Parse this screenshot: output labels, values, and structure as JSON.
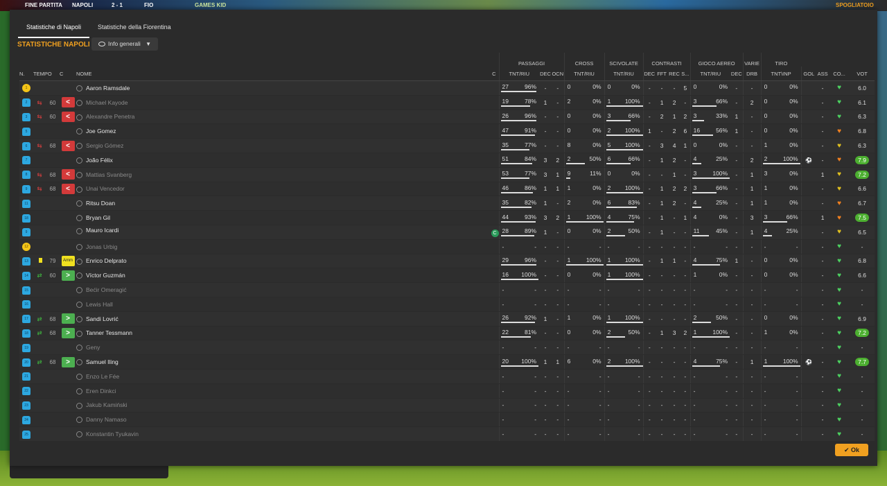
{
  "scoreboard": {
    "label": "FINE PARTITA",
    "home": "NAPOLI",
    "score": "2 - 1",
    "away": "FIO",
    "sponsor": "GAMES KID",
    "right_btn": "SPOGLIATOIO"
  },
  "tabs": [
    {
      "label": "Statistiche di Napoli",
      "active": true
    },
    {
      "label": "Statistiche della Fiorentina",
      "active": false
    }
  ],
  "section_title": "STATISTICHE NAPOLI",
  "dropdown": {
    "label": "Info generali"
  },
  "groups": {
    "passaggi": "PASSAGGI",
    "cross": "CROSS",
    "scivolate": "SCIVOLATE",
    "contrasti": "CONTRASTI",
    "gioco_aereo": "GIOCO AEREO",
    "varie": "VARIE",
    "tiro": "TIRO"
  },
  "headers": {
    "n": "N.",
    "tempo": "TEMPO",
    "c": "C",
    "nome": "NOME",
    "c2": "C",
    "pass_tnt": "TNT/RIU",
    "dec": "DEC",
    "ocn": "OCN",
    "cross_tnt": "TNT/RIU",
    "sciv_tnt": "TNT/RIU",
    "cdec": "DEC",
    "fft": "FFT",
    "rec": "REC",
    "s": "S...",
    "aer_tnt": "TNT/RIU",
    "adec": "DEC",
    "drb": "DRB",
    "tiro": "TNT\\INP",
    "gol": "GOL",
    "ass": "ASS",
    "co": "CO...",
    "vot": "VOT"
  },
  "ok_label": "Ok",
  "players": [
    {
      "n": "1",
      "gk": true,
      "tempo": "",
      "sub": "",
      "name": "Aaron Ramsdale",
      "dim": false,
      "c2": "",
      "pass": [
        "27",
        "96%"
      ],
      "dec": "-",
      "ocn": "-",
      "cross": [
        "0",
        "0%"
      ],
      "sciv": [
        "0",
        "0%"
      ],
      "cdec": "-",
      "fft": "-",
      "rec": "-",
      "s": "5",
      "aer": [
        "0",
        "0%"
      ],
      "adec": "-",
      "drb": "-",
      "tiro": [
        "0",
        "0%"
      ],
      "gol": "",
      "ass": "-",
      "heart": "g",
      "vot": "6.0",
      "good": false
    },
    {
      "n": "2",
      "gk": false,
      "tempo": "60",
      "sub": "out",
      "name": "Michael Kayode",
      "dim": true,
      "c2": "",
      "pass": [
        "19",
        "78%"
      ],
      "dec": "1",
      "ocn": "-",
      "cross": [
        "2",
        "0%"
      ],
      "sciv": [
        "1",
        "100%"
      ],
      "cdec": "-",
      "fft": "1",
      "rec": "2",
      "s": "-",
      "aer": [
        "3",
        "66%"
      ],
      "adec": "-",
      "drb": "2",
      "tiro": [
        "0",
        "0%"
      ],
      "gol": "",
      "ass": "-",
      "heart": "g",
      "vot": "6.1",
      "good": false
    },
    {
      "n": "3",
      "gk": false,
      "tempo": "60",
      "sub": "out",
      "name": "Alexandre Penetra",
      "dim": true,
      "c2": "",
      "pass": [
        "26",
        "96%"
      ],
      "dec": "-",
      "ocn": "-",
      "cross": [
        "0",
        "0%"
      ],
      "sciv": [
        "3",
        "66%"
      ],
      "cdec": "-",
      "fft": "2",
      "rec": "1",
      "s": "2",
      "aer": [
        "3",
        "33%"
      ],
      "adec": "1",
      "drb": "-",
      "tiro": [
        "0",
        "0%"
      ],
      "gol": "",
      "ass": "-",
      "heart": "g",
      "vot": "6.3",
      "good": false
    },
    {
      "n": "5",
      "gk": false,
      "tempo": "",
      "sub": "",
      "name": "Joe Gomez",
      "dim": false,
      "c2": "",
      "pass": [
        "47",
        "91%"
      ],
      "dec": "-",
      "ocn": "-",
      "cross": [
        "0",
        "0%"
      ],
      "sciv": [
        "2",
        "100%"
      ],
      "cdec": "1",
      "fft": "-",
      "rec": "2",
      "s": "6",
      "aer": [
        "16",
        "56%"
      ],
      "adec": "1",
      "drb": "-",
      "tiro": [
        "0",
        "0%"
      ],
      "gol": "",
      "ass": "-",
      "heart": "o",
      "vot": "6.8",
      "good": false
    },
    {
      "n": "6",
      "gk": false,
      "tempo": "68",
      "sub": "out",
      "name": "Sergio Gómez",
      "dim": true,
      "c2": "",
      "pass": [
        "35",
        "77%"
      ],
      "dec": "-",
      "ocn": "-",
      "cross": [
        "8",
        "0%"
      ],
      "sciv": [
        "5",
        "100%"
      ],
      "cdec": "-",
      "fft": "3",
      "rec": "4",
      "s": "1",
      "aer": [
        "0",
        "0%"
      ],
      "adec": "-",
      "drb": "-",
      "tiro": [
        "1",
        "0%"
      ],
      "gol": "",
      "ass": "-",
      "heart": "y",
      "vot": "6.3",
      "good": false
    },
    {
      "n": "7",
      "gk": false,
      "tempo": "",
      "sub": "",
      "name": "João Félix",
      "dim": false,
      "c2": "",
      "pass": [
        "51",
        "84%"
      ],
      "dec": "3",
      "ocn": "2",
      "cross": [
        "2",
        "50%"
      ],
      "sciv": [
        "6",
        "66%"
      ],
      "cdec": "-",
      "fft": "1",
      "rec": "2",
      "s": "-",
      "aer": [
        "4",
        "25%"
      ],
      "adec": "-",
      "drb": "2",
      "tiro": [
        "2",
        "100%"
      ],
      "gol": "ball",
      "ass": "-",
      "heart": "o",
      "vot": "7.9",
      "good": true
    },
    {
      "n": "8",
      "gk": false,
      "tempo": "68",
      "sub": "out",
      "name": "Mattias Svanberg",
      "dim": true,
      "c2": "",
      "pass": [
        "53",
        "77%"
      ],
      "dec": "3",
      "ocn": "1",
      "cross": [
        "9",
        "11%"
      ],
      "sciv": [
        "0",
        "0%"
      ],
      "cdec": "-",
      "fft": "-",
      "rec": "1",
      "s": "-",
      "aer": [
        "3",
        "100%"
      ],
      "adec": "-",
      "drb": "1",
      "tiro": [
        "3",
        "0%"
      ],
      "gol": "",
      "ass": "1",
      "heart": "y",
      "vot": "7.2",
      "good": true
    },
    {
      "n": "9",
      "gk": false,
      "tempo": "68",
      "sub": "out",
      "name": "Unai Vencedor",
      "dim": true,
      "c2": "",
      "pass": [
        "46",
        "86%"
      ],
      "dec": "1",
      "ocn": "1",
      "cross": [
        "1",
        "0%"
      ],
      "sciv": [
        "2",
        "100%"
      ],
      "cdec": "-",
      "fft": "1",
      "rec": "2",
      "s": "2",
      "aer": [
        "3",
        "66%"
      ],
      "adec": "-",
      "drb": "1",
      "tiro": [
        "1",
        "0%"
      ],
      "gol": "",
      "ass": "-",
      "heart": "y",
      "vot": "6.6",
      "good": false
    },
    {
      "n": "11",
      "gk": false,
      "tempo": "",
      "sub": "",
      "name": "Ritsu Doan",
      "dim": false,
      "c2": "",
      "pass": [
        "35",
        "82%"
      ],
      "dec": "1",
      "ocn": "-",
      "cross": [
        "2",
        "0%"
      ],
      "sciv": [
        "6",
        "83%"
      ],
      "cdec": "-",
      "fft": "1",
      "rec": "2",
      "s": "-",
      "aer": [
        "4",
        "25%"
      ],
      "adec": "-",
      "drb": "1",
      "tiro": [
        "1",
        "0%"
      ],
      "gol": "",
      "ass": "-",
      "heart": "o",
      "vot": "6.7",
      "good": false
    },
    {
      "n": "18",
      "gk": false,
      "tempo": "",
      "sub": "",
      "name": "Bryan Gil",
      "dim": false,
      "c2": "",
      "pass": [
        "44",
        "93%"
      ],
      "dec": "3",
      "ocn": "2",
      "cross": [
        "1",
        "100%"
      ],
      "sciv": [
        "4",
        "75%"
      ],
      "cdec": "-",
      "fft": "1",
      "rec": "-",
      "s": "1",
      "aer": [
        "4",
        "0%"
      ],
      "adec": "-",
      "drb": "3",
      "tiro": [
        "3",
        "66%"
      ],
      "gol": "",
      "ass": "1",
      "heart": "o",
      "vot": "7.5",
      "good": true
    },
    {
      "n": "9",
      "gk": false,
      "tempo": "",
      "sub": "",
      "name": "Mauro Icardi",
      "dim": false,
      "c2": "C",
      "pass": [
        "28",
        "89%"
      ],
      "dec": "1",
      "ocn": "-",
      "cross": [
        "0",
        "0%"
      ],
      "sciv": [
        "2",
        "50%"
      ],
      "cdec": "-",
      "fft": "1",
      "rec": "-",
      "s": "-",
      "aer": [
        "11",
        "45%"
      ],
      "adec": "-",
      "drb": "1",
      "tiro": [
        "4",
        "25%"
      ],
      "gol": "",
      "ass": "-",
      "heart": "y",
      "vot": "6.5",
      "good": false
    },
    {
      "n": "12",
      "gk": true,
      "tempo": "",
      "sub": "",
      "name": "Jonas Urbig",
      "dim": true,
      "c2": "",
      "pass": [
        "-",
        "-"
      ],
      "dec": "-",
      "ocn": "-",
      "cross": [
        "-",
        "-"
      ],
      "sciv": [
        "-",
        "-"
      ],
      "cdec": "-",
      "fft": "-",
      "rec": "-",
      "s": "-",
      "aer": [
        "-",
        "-"
      ],
      "adec": "-",
      "drb": "-",
      "tiro": [
        "-",
        "-"
      ],
      "gol": "",
      "ass": "-",
      "heart": "g",
      "vot": "-",
      "good": false
    },
    {
      "n": "13",
      "gk": false,
      "tempo": "79",
      "sub": "card",
      "name": "Enrico Delprato",
      "dim": false,
      "c2": "",
      "pass": [
        "29",
        "96%"
      ],
      "dec": "-",
      "ocn": "-",
      "cross": [
        "1",
        "100%"
      ],
      "sciv": [
        "1",
        "100%"
      ],
      "cdec": "-",
      "fft": "1",
      "rec": "1",
      "s": "-",
      "aer": [
        "4",
        "75%"
      ],
      "adec": "1",
      "drb": "-",
      "tiro": [
        "0",
        "0%"
      ],
      "gol": "",
      "ass": "-",
      "heart": "g",
      "vot": "6.8",
      "good": false
    },
    {
      "n": "14",
      "gk": false,
      "tempo": "60",
      "sub": "in",
      "name": "Víctor Guzmán",
      "dim": false,
      "c2": "",
      "pass": [
        "16",
        "100%"
      ],
      "dec": "-",
      "ocn": "-",
      "cross": [
        "0",
        "0%"
      ],
      "sciv": [
        "1",
        "100%"
      ],
      "cdec": "-",
      "fft": "-",
      "rec": "-",
      "s": "-",
      "aer": [
        "1",
        "0%"
      ],
      "adec": "-",
      "drb": "-",
      "tiro": [
        "0",
        "0%"
      ],
      "gol": "",
      "ass": "-",
      "heart": "g",
      "vot": "6.6",
      "good": false
    },
    {
      "n": "15",
      "gk": false,
      "tempo": "",
      "sub": "",
      "name": "Bećir Omeragić",
      "dim": true,
      "c2": "",
      "pass": [
        "-",
        "-"
      ],
      "dec": "-",
      "ocn": "-",
      "cross": [
        "-",
        "-"
      ],
      "sciv": [
        "-",
        "-"
      ],
      "cdec": "-",
      "fft": "-",
      "rec": "-",
      "s": "-",
      "aer": [
        "-",
        "-"
      ],
      "adec": "-",
      "drb": "-",
      "tiro": [
        "-",
        "-"
      ],
      "gol": "",
      "ass": "-",
      "heart": "g",
      "vot": "-",
      "good": false
    },
    {
      "n": "16",
      "gk": false,
      "tempo": "",
      "sub": "",
      "name": "Lewis Hall",
      "dim": true,
      "c2": "",
      "pass": [
        "-",
        "-"
      ],
      "dec": "-",
      "ocn": "-",
      "cross": [
        "-",
        "-"
      ],
      "sciv": [
        "-",
        "-"
      ],
      "cdec": "-",
      "fft": "-",
      "rec": "-",
      "s": "-",
      "aer": [
        "-",
        "-"
      ],
      "adec": "-",
      "drb": "-",
      "tiro": [
        "-",
        "-"
      ],
      "gol": "",
      "ass": "-",
      "heart": "g",
      "vot": "-",
      "good": false
    },
    {
      "n": "17",
      "gk": false,
      "tempo": "68",
      "sub": "in",
      "name": "Sandi Lovrić",
      "dim": false,
      "c2": "",
      "pass": [
        "26",
        "92%"
      ],
      "dec": "1",
      "ocn": "-",
      "cross": [
        "1",
        "0%"
      ],
      "sciv": [
        "1",
        "100%"
      ],
      "cdec": "-",
      "fft": "-",
      "rec": "-",
      "s": "-",
      "aer": [
        "2",
        "50%"
      ],
      "adec": "-",
      "drb": "-",
      "tiro": [
        "0",
        "0%"
      ],
      "gol": "",
      "ass": "-",
      "heart": "g",
      "vot": "6.9",
      "good": false
    },
    {
      "n": "18",
      "gk": false,
      "tempo": "68",
      "sub": "in",
      "name": "Tanner Tessmann",
      "dim": false,
      "c2": "",
      "pass": [
        "22",
        "81%"
      ],
      "dec": "-",
      "ocn": "-",
      "cross": [
        "0",
        "0%"
      ],
      "sciv": [
        "2",
        "50%"
      ],
      "cdec": "-",
      "fft": "1",
      "rec": "3",
      "s": "2",
      "aer": [
        "1",
        "100%"
      ],
      "adec": "-",
      "drb": "-",
      "tiro": [
        "1",
        "0%"
      ],
      "gol": "",
      "ass": "-",
      "heart": "g",
      "vot": "7.2",
      "good": true
    },
    {
      "n": "19",
      "gk": false,
      "tempo": "",
      "sub": "",
      "name": "Geny",
      "dim": true,
      "c2": "",
      "pass": [
        "-",
        "-"
      ],
      "dec": "-",
      "ocn": "-",
      "cross": [
        "-",
        "-"
      ],
      "sciv": [
        "-",
        "-"
      ],
      "cdec": "-",
      "fft": "-",
      "rec": "-",
      "s": "-",
      "aer": [
        "-",
        "-"
      ],
      "adec": "-",
      "drb": "-",
      "tiro": [
        "-",
        "-"
      ],
      "gol": "",
      "ass": "-",
      "heart": "g",
      "vot": "-",
      "good": false
    },
    {
      "n": "20",
      "gk": false,
      "tempo": "68",
      "sub": "in",
      "name": "Samuel Iling",
      "dim": false,
      "c2": "",
      "pass": [
        "20",
        "100%"
      ],
      "dec": "1",
      "ocn": "1",
      "cross": [
        "6",
        "0%"
      ],
      "sciv": [
        "2",
        "100%"
      ],
      "cdec": "-",
      "fft": "-",
      "rec": "-",
      "s": "-",
      "aer": [
        "4",
        "75%"
      ],
      "adec": "-",
      "drb": "1",
      "tiro": [
        "1",
        "100%"
      ],
      "gol": "ball",
      "ass": "-",
      "heart": "g",
      "vot": "7.7",
      "good": true
    },
    {
      "n": "21",
      "gk": false,
      "tempo": "",
      "sub": "",
      "name": "Enzo Le Fée",
      "dim": true,
      "c2": "",
      "pass": [
        "-",
        "-"
      ],
      "dec": "-",
      "ocn": "-",
      "cross": [
        "-",
        "-"
      ],
      "sciv": [
        "-",
        "-"
      ],
      "cdec": "-",
      "fft": "-",
      "rec": "-",
      "s": "-",
      "aer": [
        "-",
        "-"
      ],
      "adec": "-",
      "drb": "-",
      "tiro": [
        "-",
        "-"
      ],
      "gol": "",
      "ass": "-",
      "heart": "g",
      "vot": "-",
      "good": false
    },
    {
      "n": "22",
      "gk": false,
      "tempo": "",
      "sub": "",
      "name": "Eren Dinkci",
      "dim": true,
      "c2": "",
      "pass": [
        "-",
        "-"
      ],
      "dec": "-",
      "ocn": "-",
      "cross": [
        "-",
        "-"
      ],
      "sciv": [
        "-",
        "-"
      ],
      "cdec": "-",
      "fft": "-",
      "rec": "-",
      "s": "-",
      "aer": [
        "-",
        "-"
      ],
      "adec": "-",
      "drb": "-",
      "tiro": [
        "-",
        "-"
      ],
      "gol": "",
      "ass": "-",
      "heart": "g",
      "vot": "-",
      "good": false
    },
    {
      "n": "23",
      "gk": false,
      "tempo": "",
      "sub": "",
      "name": "Jakub Kamiński",
      "dim": true,
      "c2": "",
      "pass": [
        "-",
        "-"
      ],
      "dec": "-",
      "ocn": "-",
      "cross": [
        "-",
        "-"
      ],
      "sciv": [
        "-",
        "-"
      ],
      "cdec": "-",
      "fft": "-",
      "rec": "-",
      "s": "-",
      "aer": [
        "-",
        "-"
      ],
      "adec": "-",
      "drb": "-",
      "tiro": [
        "-",
        "-"
      ],
      "gol": "",
      "ass": "-",
      "heart": "g",
      "vot": "-",
      "good": false
    },
    {
      "n": "24",
      "gk": false,
      "tempo": "",
      "sub": "",
      "name": "Danny Namaso",
      "dim": true,
      "c2": "",
      "pass": [
        "-",
        "-"
      ],
      "dec": "-",
      "ocn": "-",
      "cross": [
        "-",
        "-"
      ],
      "sciv": [
        "-",
        "-"
      ],
      "cdec": "-",
      "fft": "-",
      "rec": "-",
      "s": "-",
      "aer": [
        "-",
        "-"
      ],
      "adec": "-",
      "drb": "-",
      "tiro": [
        "-",
        "-"
      ],
      "gol": "",
      "ass": "-",
      "heart": "g",
      "vot": "-",
      "good": false
    },
    {
      "n": "25",
      "gk": false,
      "tempo": "",
      "sub": "",
      "name": "Konstantin Tyukavin",
      "dim": true,
      "c2": "",
      "pass": [
        "-",
        "-"
      ],
      "dec": "-",
      "ocn": "-",
      "cross": [
        "-",
        "-"
      ],
      "sciv": [
        "-",
        "-"
      ],
      "cdec": "-",
      "fft": "-",
      "rec": "-",
      "s": "-",
      "aer": [
        "-",
        "-"
      ],
      "adec": "-",
      "drb": "-",
      "tiro": [
        "-",
        "-"
      ],
      "gol": "",
      "ass": "-",
      "heart": "g",
      "vot": "-",
      "good": false
    }
  ]
}
